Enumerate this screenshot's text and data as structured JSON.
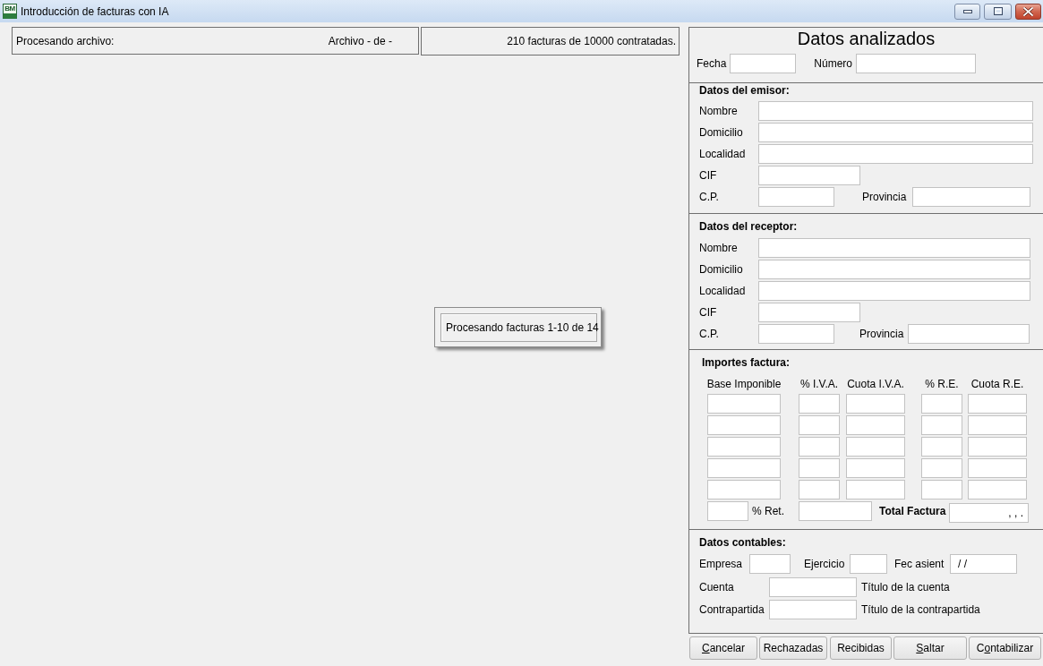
{
  "window": {
    "logo_text": "BM",
    "title": "Introducción de facturas con IA"
  },
  "status_bar": {
    "file_label": "Procesando archivo:",
    "file_counter": "Archivo - de -",
    "quota": "210 facturas de 10000 contratadas."
  },
  "progress_popup": {
    "message": "Procesando facturas 1-10 de 14"
  },
  "analysis_panel": {
    "title": "Datos analizados",
    "invoice_fields": [
      {
        "label": "Fecha"
      },
      {
        "label": "Número"
      }
    ],
    "issuer": {
      "title": "Datos del emisor:",
      "rows": [
        {
          "kind": "wide",
          "label": "Nombre"
        },
        {
          "kind": "wide",
          "label": "Domicilio"
        },
        {
          "kind": "wide",
          "label": "Localidad"
        },
        {
          "kind": "short",
          "label": "CIF"
        },
        {
          "kind": "pair",
          "label": "C.P.",
          "second_label": "Provincia"
        }
      ]
    },
    "receiver": {
      "title": "Datos del receptor:",
      "rows": [
        {
          "kind": "wide",
          "label": "Nombre"
        },
        {
          "kind": "wide",
          "label": "Domicilio"
        },
        {
          "kind": "wide",
          "label": "Localidad"
        },
        {
          "kind": "short",
          "label": "CIF"
        },
        {
          "kind": "pair",
          "label": "C.P.",
          "second_label": "Provincia"
        }
      ]
    },
    "amounts": {
      "title": "Importes factura:",
      "columns": [
        "Base Imponible",
        "% I.V.A.",
        "Cuota I.V.A.",
        "% R.E.",
        "Cuota R.E."
      ],
      "withholding_label": "% Ret.",
      "total_label": "Total Factura",
      "total_value": ", , ."
    },
    "accounting": {
      "title": "Datos contables:",
      "fields": [
        {
          "label": "Empresa"
        },
        {
          "label": "Ejercicio"
        },
        {
          "label": "Fec asient",
          "value": "/ /"
        }
      ],
      "accounts": [
        {
          "label": "Cuenta",
          "title_label": "Título de la cuenta"
        },
        {
          "label": "Contrapartida",
          "title_label": "Título de la contrapartida"
        }
      ]
    }
  },
  "buttons": [
    {
      "access_key": "C",
      "label_rest": "ancelar"
    },
    {
      "label": "Rechazadas"
    },
    {
      "label": "Recibidas"
    },
    {
      "access_key": "S",
      "label_rest": "altar"
    },
    {
      "label_start": "C",
      "access_key": "o",
      "label_rest": "ntabilizar"
    }
  ]
}
